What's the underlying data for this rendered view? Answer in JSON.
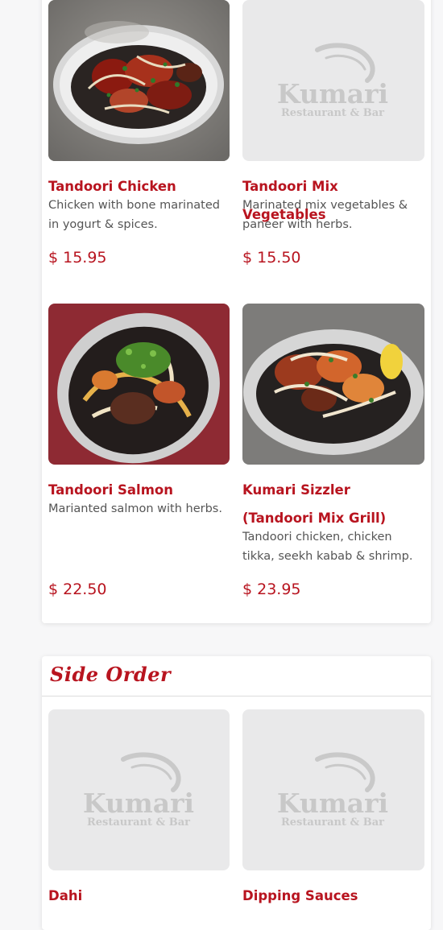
{
  "brand": {
    "logo_name": "Kumari",
    "logo_sub": "Restaurant & Bar",
    "accent_color": "#b8141f"
  },
  "tandoori": {
    "items": [
      {
        "name": "Tandoori Chicken",
        "desc": "Chicken with bone marinated in yogurt & spices.",
        "price": "$ 15.95",
        "photo": "tandoori-chicken-photo"
      },
      {
        "name": "Tandoori Mix Vegetables",
        "desc": "Marinated mix vegetables & paneer with herbs.",
        "price": "$ 15.50",
        "photo": "placeholder-logo"
      },
      {
        "name": "Tandoori Salmon",
        "desc": "Marianted salmon with herbs.",
        "price": "$ 22.50",
        "photo": "tandoori-salmon-photo"
      },
      {
        "name": "Kumari Sizzler (Tandoori Mix Grill)",
        "desc": "Tandoori chicken, chicken tikka, seekh kabab & shrimp.",
        "price": "$ 23.95",
        "photo": "mixed-grill-photo"
      }
    ]
  },
  "side_order": {
    "title": "Side Order",
    "items": [
      {
        "name": "Dahi",
        "photo": "placeholder-logo"
      },
      {
        "name": "Dipping Sauces",
        "photo": "placeholder-logo"
      }
    ]
  }
}
